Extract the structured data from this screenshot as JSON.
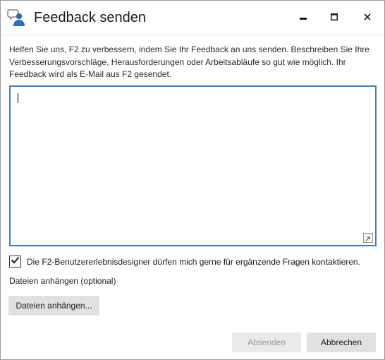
{
  "window": {
    "title": "Feedback senden"
  },
  "intro_text": "Helfen Sie uns, F2 zu verbessern, indem Sie Ihr Feedback an uns senden. Beschreiben Sie Ihre Verbesserungsvorschläge, Herausforderungen oder Arbeitsabläufe so gut wie möglich. Ihr Feedback wird als E-Mail aus F2 gesendet.",
  "feedback": {
    "value": ""
  },
  "contact_checkbox": {
    "label": "Die F2-Benutzererlebnisdesigner dürfen mich gerne für ergänzende Fragen kontaktieren.",
    "checked": true
  },
  "attachments": {
    "label": "Dateien anhängen (optional)",
    "button_label": "Dateien anhängen..."
  },
  "actions": {
    "send_label": "Absenden",
    "send_enabled": false,
    "cancel_label": "Abbrechen"
  },
  "icons": {
    "app": "feedback-speech-bubble-person-icon",
    "minimize": "minimize-icon",
    "maximize": "maximize-icon",
    "close": "close-icon",
    "expand": "expand-icon",
    "check": "checkmark-icon"
  },
  "colors": {
    "accent_border": "#3d7fc1",
    "button_bg": "#e1e1e1",
    "disabled_text": "#9a9a9a"
  }
}
